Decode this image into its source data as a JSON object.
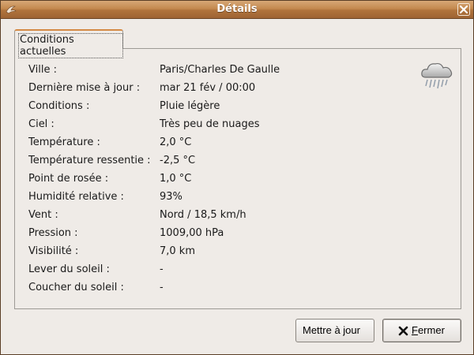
{
  "window": {
    "title": "Détails"
  },
  "tab": {
    "label": "Conditions actuelles"
  },
  "details": [
    {
      "label": "Ville :",
      "value": "Paris/Charles De Gaulle"
    },
    {
      "label": "Dernière mise à jour :",
      "value": "mar 21 fév / 00:00"
    },
    {
      "label": "Conditions :",
      "value": "Pluie légère"
    },
    {
      "label": "Ciel :",
      "value": "Très peu de nuages"
    },
    {
      "label": "Température :",
      "value": "2,0 °C"
    },
    {
      "label": "Température ressentie :",
      "value": "-2,5 °C"
    },
    {
      "label": "Point de rosée :",
      "value": "1,0 °C"
    },
    {
      "label": "Humidité relative :",
      "value": "93%"
    },
    {
      "label": "Vent :",
      "value": "Nord / 18,5 km/h"
    },
    {
      "label": "Pression :",
      "value": "1009,00 hPa"
    },
    {
      "label": "Visibilité :",
      "value": "7,0 km"
    },
    {
      "label": "Lever du soleil :",
      "value": "-"
    },
    {
      "label": "Coucher du soleil :",
      "value": "-"
    }
  ],
  "buttons": {
    "update_label": "Mettre à jour",
    "close_label_rest": "ermer",
    "close_mnemonic": "F"
  },
  "icons": {
    "weather": "rain-cloud-icon",
    "close": "close-icon",
    "menu": "window-menu-icon"
  },
  "colors": {
    "titlebar": "#c4894f",
    "tab_accent": "#d48a45",
    "background": "#efebe7"
  }
}
